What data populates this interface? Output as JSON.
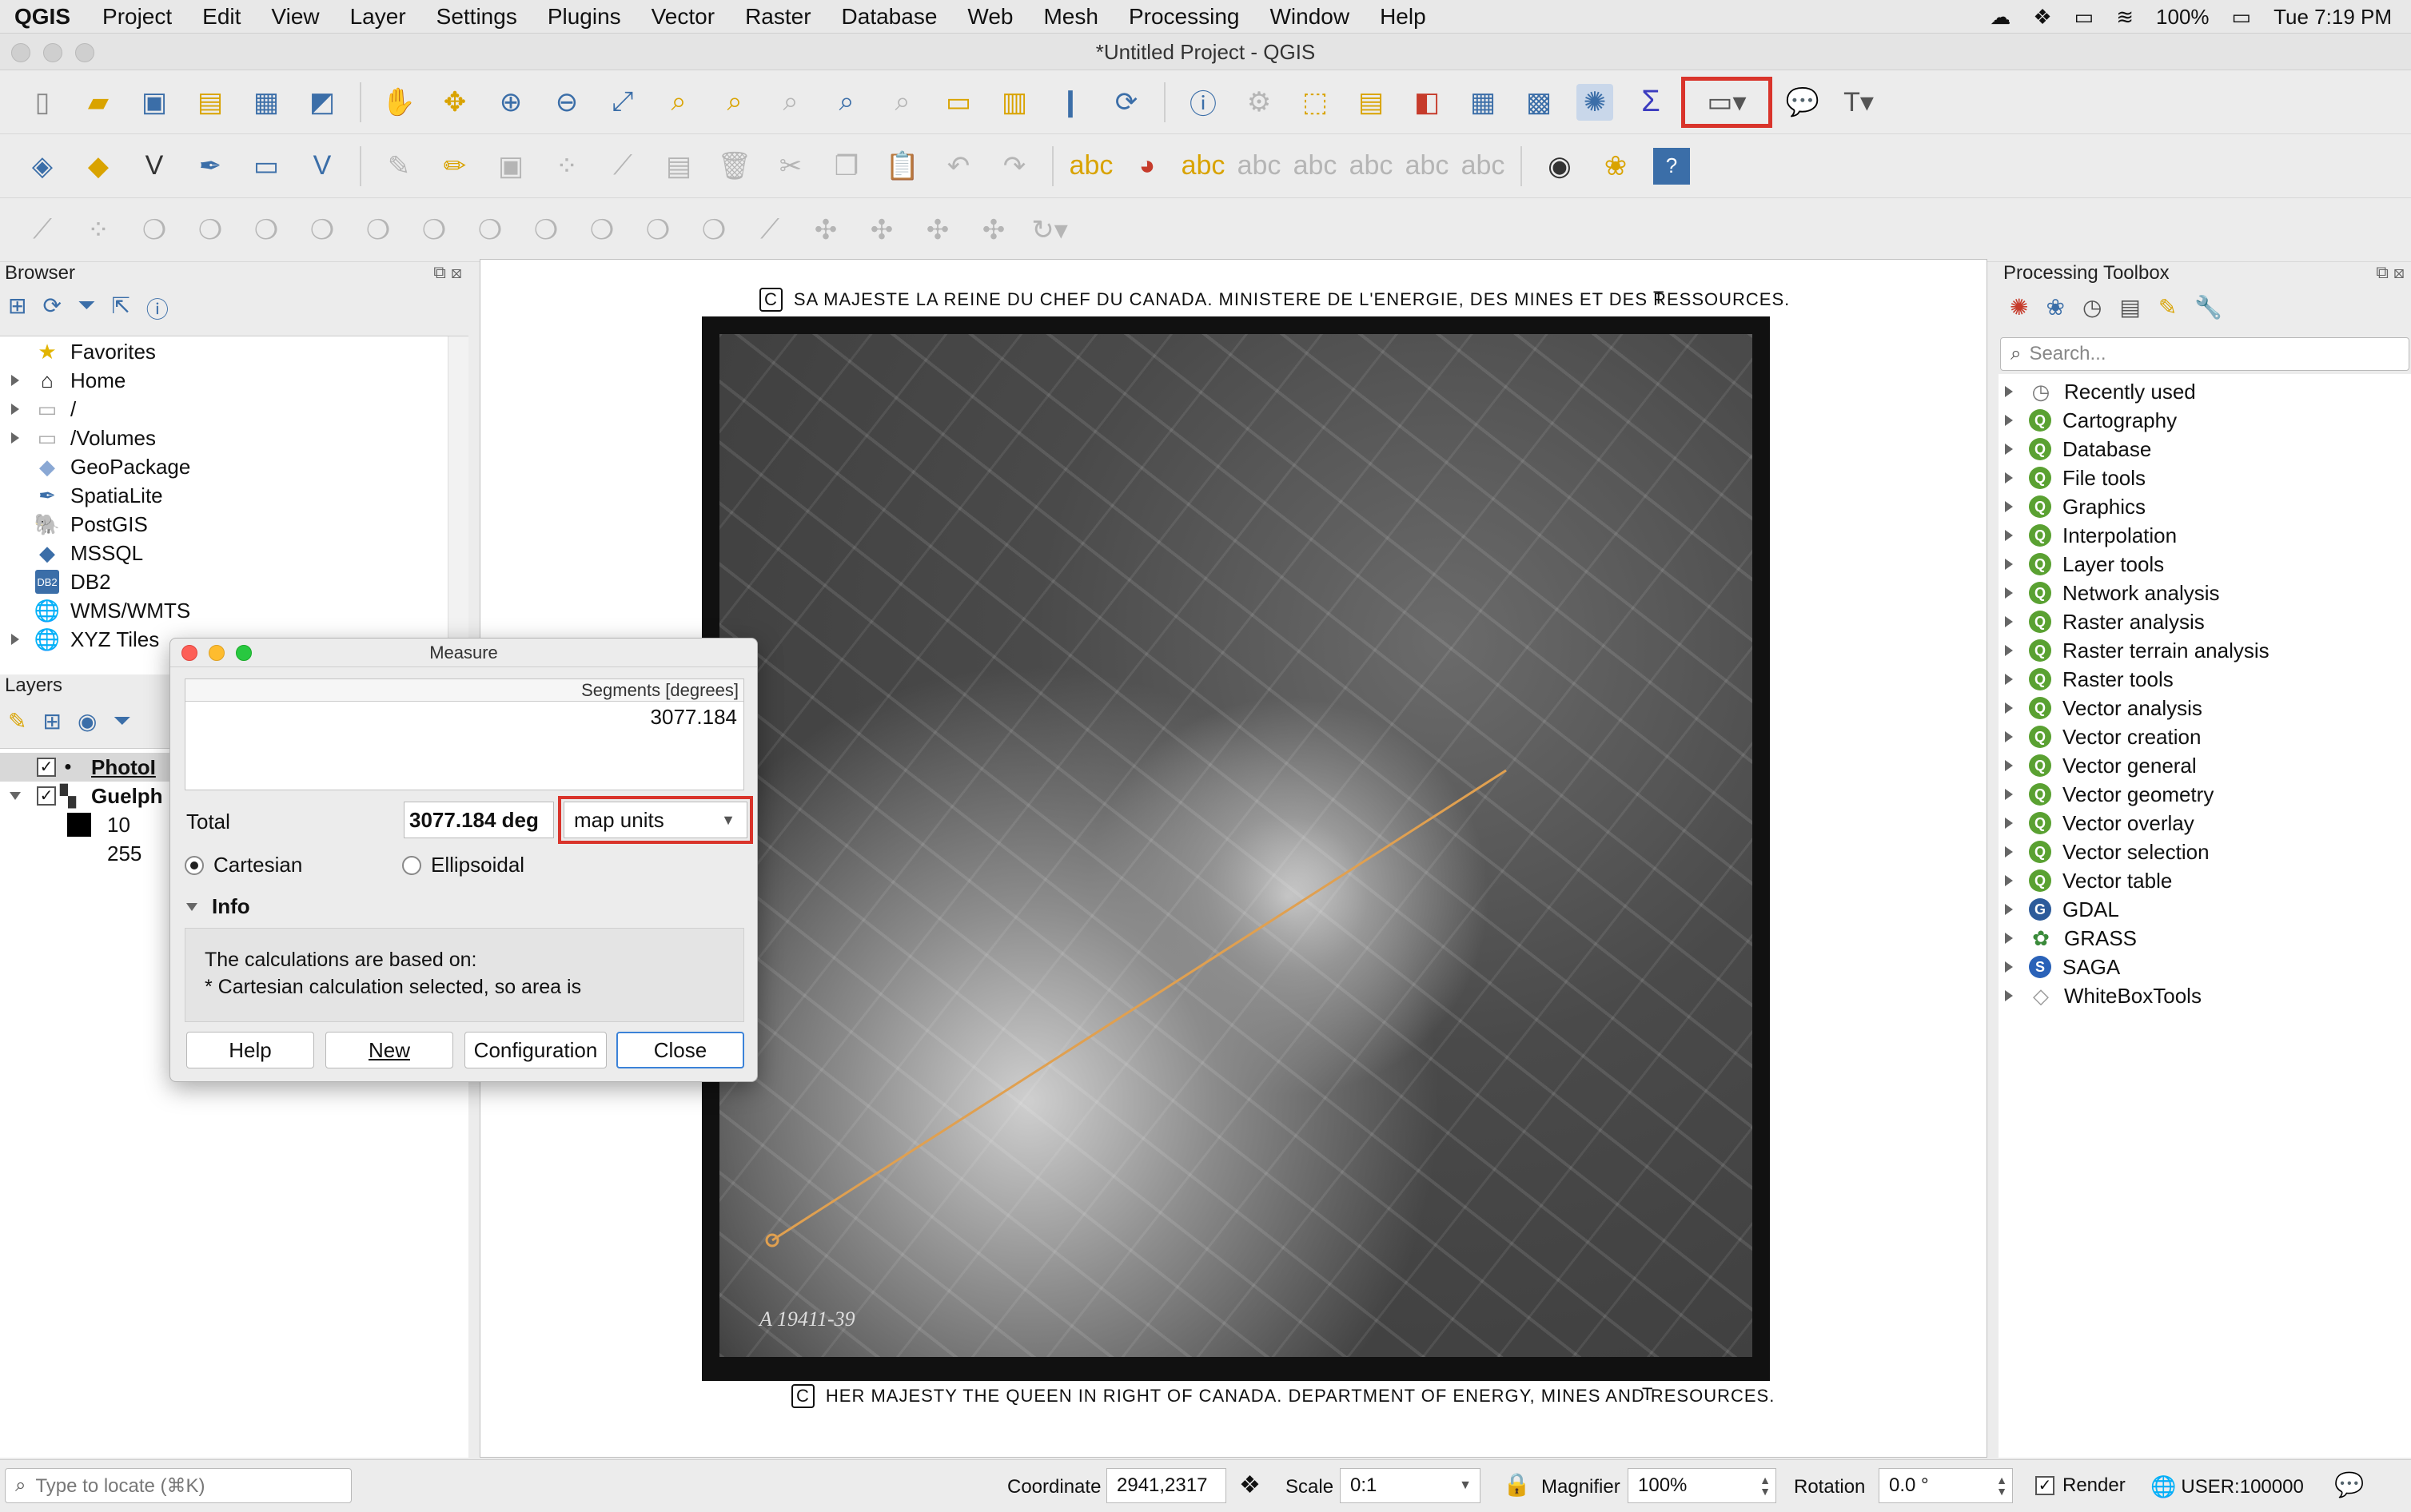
{
  "menubar": {
    "app": "QGIS",
    "items": [
      "Project",
      "Edit",
      "View",
      "Layer",
      "Settings",
      "Plugins",
      "Vector",
      "Raster",
      "Database",
      "Web",
      "Mesh",
      "Processing",
      "Window",
      "Help"
    ],
    "battery": "100%",
    "clock": "Tue 7:19 PM"
  },
  "window": {
    "title": "*Untitled Project - QGIS"
  },
  "browser": {
    "title": "Browser",
    "items": [
      {
        "label": "Favorites",
        "icon": "star-icon"
      },
      {
        "label": "Home",
        "icon": "home-icon"
      },
      {
        "label": "/",
        "icon": "folder-icon"
      },
      {
        "label": "/Volumes",
        "icon": "folder-icon"
      },
      {
        "label": "GeoPackage",
        "icon": "geopackage-icon"
      },
      {
        "label": "SpatiaLite",
        "icon": "spatialite-icon"
      },
      {
        "label": "PostGIS",
        "icon": "postgis-icon"
      },
      {
        "label": "MSSQL",
        "icon": "mssql-icon"
      },
      {
        "label": "DB2",
        "icon": "db2-icon"
      },
      {
        "label": "WMS/WMTS",
        "icon": "globe-icon"
      },
      {
        "label": "XYZ Tiles",
        "icon": "globe-icon"
      }
    ]
  },
  "layers": {
    "title": "Layers",
    "items": [
      {
        "label": "PhotoI"
      },
      {
        "label": "Guelph"
      }
    ],
    "legend": [
      "10",
      "255"
    ]
  },
  "measure": {
    "title": "Measure",
    "segments_header": "Segments [degrees]",
    "segment_value": "3077.184",
    "total_label": "Total",
    "total_value": "3077.184 deg",
    "units": "map units",
    "cartesian": "Cartesian",
    "ellipsoidal": "Ellipsoidal",
    "info_label": "Info",
    "info_line1": "The calculations are based on:",
    "info_line2": "* Cartesian calculation selected, so area is",
    "buttons": {
      "help": "Help",
      "new": "New",
      "config": "Configuration",
      "close": "Close"
    }
  },
  "map": {
    "top_caption": "SA MAJESTE LA REINE DU CHEF DU CANADA.  MINISTERE DE L'ENERGIE, DES MINES ET DES RESSOURCES.",
    "top_t": "T",
    "bottom_caption": "HER MAJESTY THE QUEEN IN RIGHT OF CANADA.  DEPARTMENT OF ENERGY, MINES AND RESOURCES.",
    "bottom_t": "T",
    "c_symbol": "C",
    "film_label": "A 19411-39"
  },
  "toolbox": {
    "title": "Processing Toolbox",
    "search_placeholder": "Search...",
    "items": [
      {
        "label": "Recently used",
        "icon": "clock-icon"
      },
      {
        "label": "Cartography",
        "icon": "qgis-q-icon"
      },
      {
        "label": "Database",
        "icon": "qgis-q-icon"
      },
      {
        "label": "File tools",
        "icon": "qgis-q-icon"
      },
      {
        "label": "Graphics",
        "icon": "qgis-q-icon"
      },
      {
        "label": "Interpolation",
        "icon": "qgis-q-icon"
      },
      {
        "label": "Layer tools",
        "icon": "qgis-q-icon"
      },
      {
        "label": "Network analysis",
        "icon": "qgis-q-icon"
      },
      {
        "label": "Raster analysis",
        "icon": "qgis-q-icon"
      },
      {
        "label": "Raster terrain analysis",
        "icon": "qgis-q-icon"
      },
      {
        "label": "Raster tools",
        "icon": "qgis-q-icon"
      },
      {
        "label": "Vector analysis",
        "icon": "qgis-q-icon"
      },
      {
        "label": "Vector creation",
        "icon": "qgis-q-icon"
      },
      {
        "label": "Vector general",
        "icon": "qgis-q-icon"
      },
      {
        "label": "Vector geometry",
        "icon": "qgis-q-icon"
      },
      {
        "label": "Vector overlay",
        "icon": "qgis-q-icon"
      },
      {
        "label": "Vector selection",
        "icon": "qgis-q-icon"
      },
      {
        "label": "Vector table",
        "icon": "qgis-q-icon"
      },
      {
        "label": "GDAL",
        "icon": "gdal-icon"
      },
      {
        "label": "GRASS",
        "icon": "grass-icon"
      },
      {
        "label": "SAGA",
        "icon": "saga-icon"
      },
      {
        "label": "WhiteBoxTools",
        "icon": "whitebox-icon"
      }
    ]
  },
  "statusbar": {
    "locate_placeholder": "Type to locate (⌘K)",
    "coordinate_label": "Coordinate",
    "coordinate_value": "2941,2317",
    "scale_label": "Scale",
    "scale_value": "0:1",
    "magnifier_label": "Magnifier",
    "magnifier_value": "100%",
    "rotation_label": "Rotation",
    "rotation_value": "0.0 °",
    "render_label": "Render",
    "crs": "USER:100000"
  },
  "colors": {
    "highlight": "#d9342b",
    "measure_line": "#e0a050",
    "accent": "#3b82d8"
  }
}
